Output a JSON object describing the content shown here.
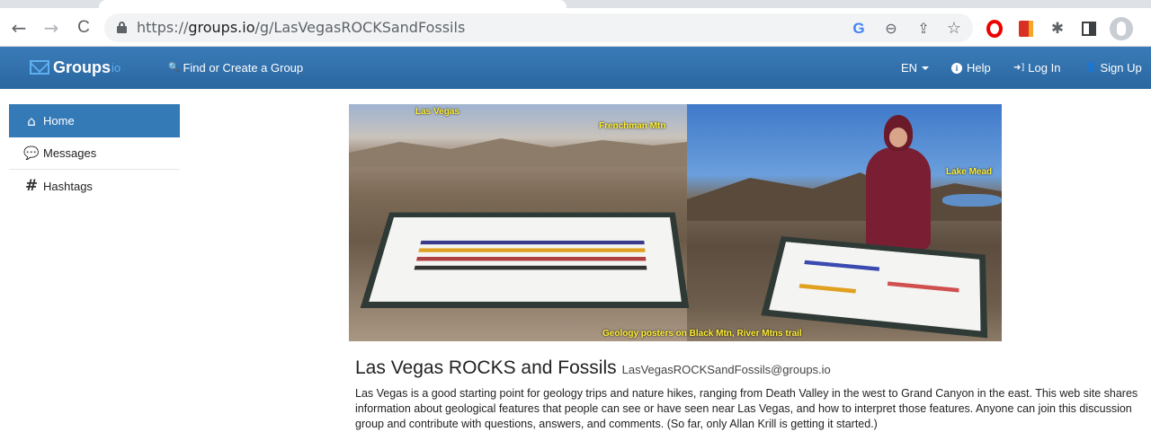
{
  "browser": {
    "url_prefix": "https://",
    "url_host": "groups.io",
    "url_path": "/g/LasVegasROCKSandFossils",
    "back_glyph": "←",
    "forward_glyph": "→",
    "reload_glyph": "C",
    "google_glyph": "G",
    "zoom_glyph": "⊖",
    "share_glyph": "⇪",
    "bookmark_glyph": "☆",
    "extensions_glyph": "✱"
  },
  "navbar": {
    "brand_name": "Groups",
    "brand_tld": "io",
    "find_icon": "🔍",
    "find_label": "Find or Create a Group",
    "language_label": "EN",
    "help_icon": "i",
    "help_label": "Help",
    "login_icon": "➜]",
    "login_label": "Log In",
    "signup_icon": "👤",
    "signup_label": "Sign Up"
  },
  "sidebar": {
    "items": [
      {
        "label": "Home",
        "icon": "⌂"
      },
      {
        "label": "Messages",
        "icon": "💬"
      },
      {
        "label": "Hashtags",
        "icon": "#"
      }
    ]
  },
  "banner": {
    "captions": {
      "las_vegas": "Las Vegas",
      "frenchman": "Frenchman Mtn",
      "lake_mead": "Lake Mead",
      "bottom": "Geology posters on Black Mtn, River Mtns trail"
    }
  },
  "group": {
    "title": "Las Vegas ROCKS and Fossils",
    "email": "LasVegasROCKSandFossils@groups.io",
    "description": "Las Vegas is a good starting point for geology trips and nature hikes, ranging from Death Valley in the west to Grand Canyon in the east. This web site shares information about geological features that people can see or have seen near Las Vegas, and how to interpret those features. Anyone can join this discussion group and contribute with questions, answers, and comments. (So far, only Allan Krill is getting it started.)"
  },
  "colors": {
    "navbar": "#2e6da4",
    "active_sidebar": "#337ab7",
    "brand_accent": "#5fb0f0",
    "caption": "#ffee33"
  }
}
